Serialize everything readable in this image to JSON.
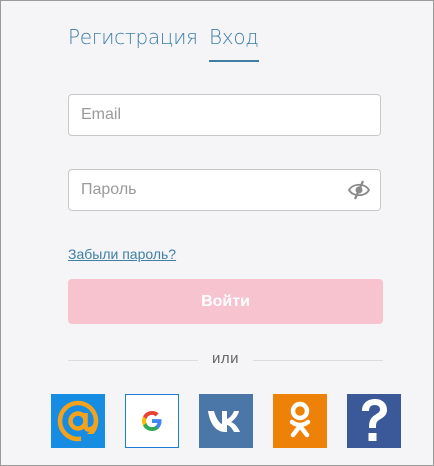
{
  "tabs": {
    "register": "Регистрация",
    "login": "Вход"
  },
  "form": {
    "email_placeholder": "Email",
    "email_value": "",
    "password_placeholder": "Пароль",
    "password_value": "",
    "forgot_link": "Забыли пароль?",
    "submit_label": "Войти"
  },
  "divider": {
    "label": "или"
  },
  "social": [
    {
      "id": "mail-ru",
      "icon": "at-sign-icon",
      "color": "#168de2"
    },
    {
      "id": "google",
      "icon": "google-g-icon",
      "color": "#ffffff"
    },
    {
      "id": "vk",
      "icon": "vk-logo-icon",
      "color": "#4a76a8"
    },
    {
      "id": "odnoklassniki",
      "icon": "ok-logo-icon",
      "color": "#ee8208"
    },
    {
      "id": "other",
      "icon": "question-mark-icon",
      "color": "#3b5998"
    }
  ],
  "colors": {
    "accent": "#3f7fa6",
    "button_disabled": "#f6c3cf",
    "background": "#f5f5f7"
  }
}
